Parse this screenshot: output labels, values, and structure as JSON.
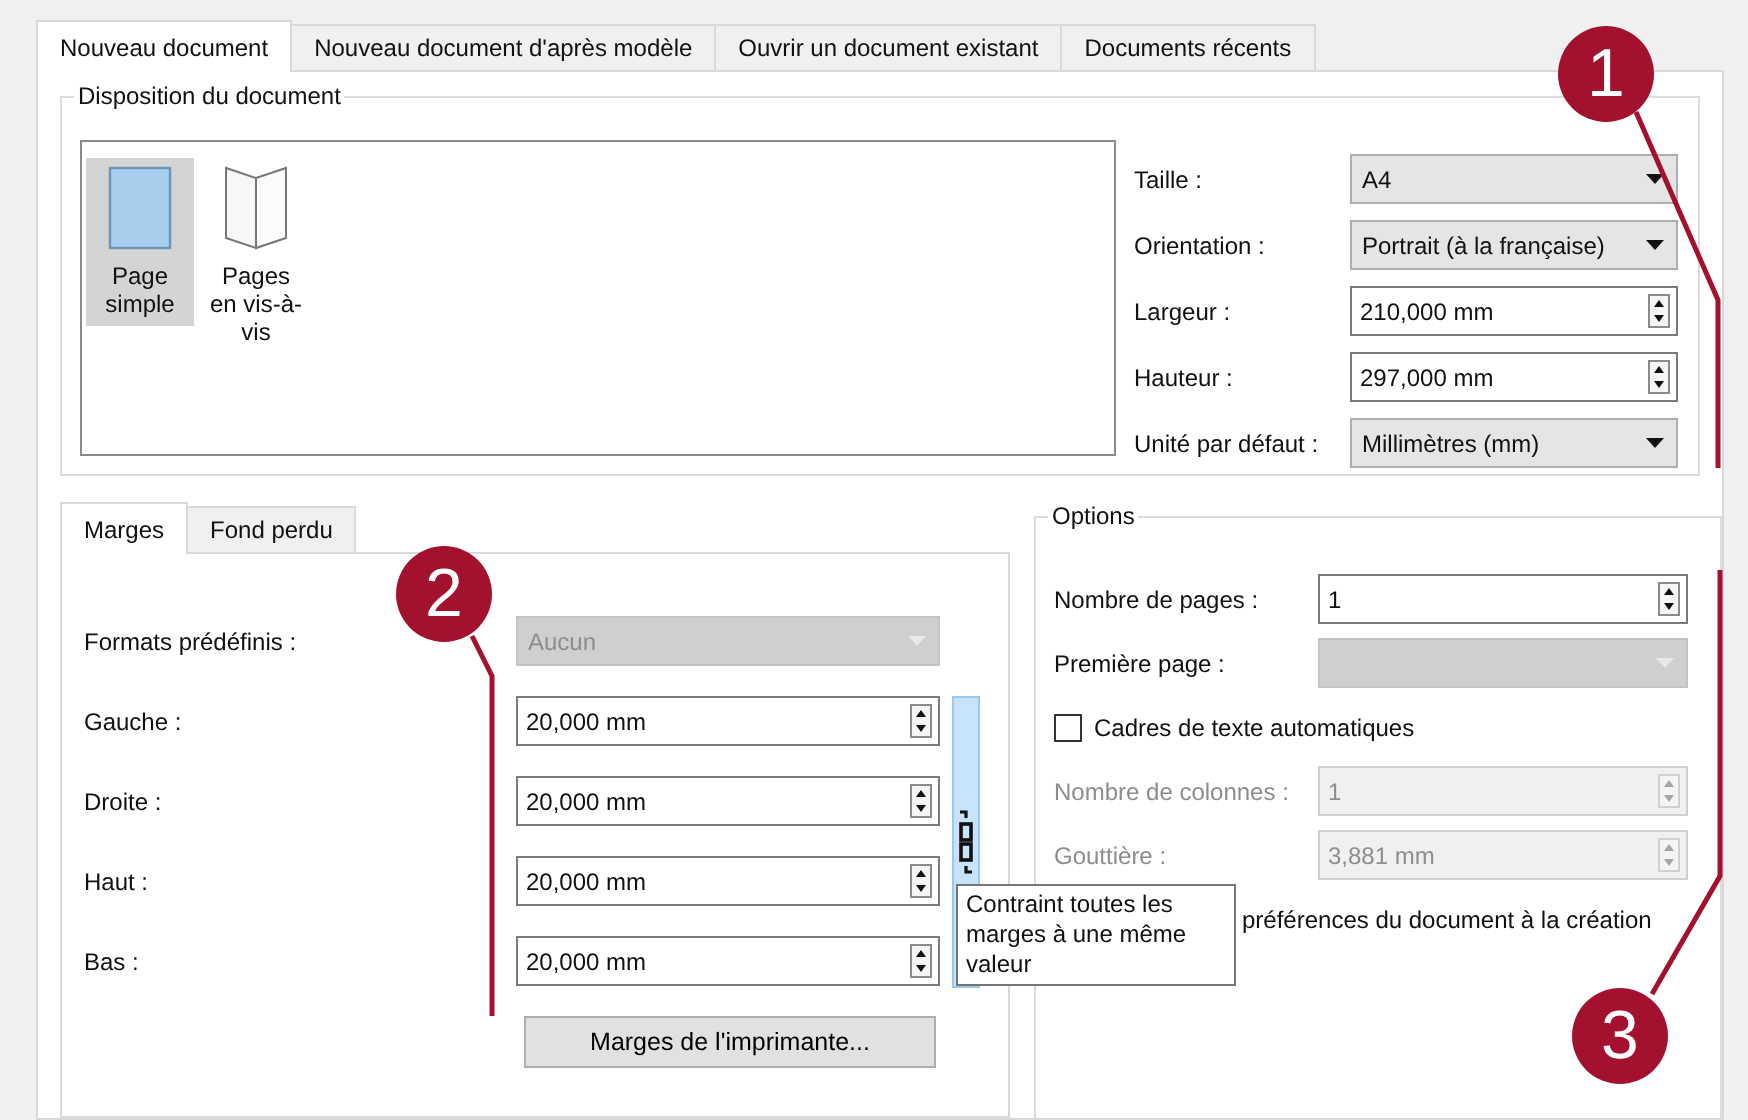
{
  "tabs": [
    {
      "label": "Nouveau document",
      "selected": true
    },
    {
      "label": "Nouveau document d'après modèle",
      "selected": false
    },
    {
      "label": "Ouvrir un document existant",
      "selected": false
    },
    {
      "label": "Documents récents",
      "selected": false
    }
  ],
  "layout_group": {
    "title": "Disposition du document",
    "layouts": [
      {
        "label": "Page simple",
        "kind": "single",
        "selected": true
      },
      {
        "label": "Pages en vis-à-vis",
        "kind": "facing",
        "selected": false
      }
    ],
    "fields": [
      {
        "label": "Taille :",
        "kind": "dropdown",
        "value": "A4"
      },
      {
        "label": "Orientation :",
        "kind": "dropdown",
        "value": "Portrait (à la française)"
      },
      {
        "label": "Largeur :",
        "kind": "spin",
        "value": "210,000 mm"
      },
      {
        "label": "Hauteur :",
        "kind": "spin",
        "value": "297,000 mm"
      },
      {
        "label": "Unité par défaut :",
        "kind": "dropdown",
        "value": "Millimètres (mm)"
      }
    ]
  },
  "margin_tabs": [
    {
      "label": "Marges",
      "selected": true
    },
    {
      "label": "Fond perdu",
      "selected": false
    }
  ],
  "margins": {
    "preset": {
      "label": "Formats prédéfinis :",
      "value": "Aucun",
      "disabled": true
    },
    "fields": [
      {
        "label": "Gauche :",
        "value": "20,000 mm"
      },
      {
        "label": "Droite :",
        "value": "20,000 mm"
      },
      {
        "label": "Haut :",
        "value": "20,000 mm"
      },
      {
        "label": "Bas :",
        "value": "20,000 mm"
      }
    ],
    "link_tooltip": "Contraint toutes les marges à une même valeur",
    "printer_button": "Marges de l'imprimante..."
  },
  "options": {
    "title": "Options",
    "rows": [
      {
        "kind": "spin",
        "label": "Nombre de pages :",
        "value": "1",
        "disabled": false
      },
      {
        "kind": "dropdown",
        "label": "Première page  :",
        "disabled": true
      },
      {
        "kind": "checkbox",
        "label": "Cadres de texte automatiques",
        "checked": false
      },
      {
        "kind": "spin",
        "label": "Nombre de colonnes :",
        "value": "1",
        "disabled": true
      },
      {
        "kind": "spin",
        "label": "Gouttière :",
        "value": "3,881 mm",
        "disabled": true
      },
      {
        "kind": "note",
        "label": "préférences du document à la création"
      }
    ]
  },
  "callouts": [
    "1",
    "2",
    "3"
  ]
}
